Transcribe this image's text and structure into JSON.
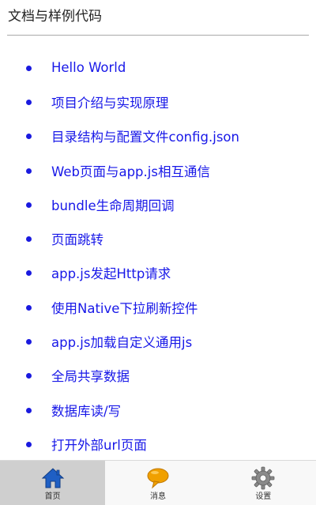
{
  "header": {
    "title": "文档与样例代码"
  },
  "docs": {
    "items": [
      {
        "label": "Hello World"
      },
      {
        "label": "项目介绍与实现原理"
      },
      {
        "label": "目录结构与配置文件config.json"
      },
      {
        "label": "Web页面与app.js相互通信"
      },
      {
        "label": "bundle生命周期回调"
      },
      {
        "label": "页面跳转"
      },
      {
        "label": "app.js发起Http请求"
      },
      {
        "label": "使用Native下拉刷新控件"
      },
      {
        "label": "app.js加载自定义通用js"
      },
      {
        "label": "全局共享数据"
      },
      {
        "label": "数据库读/写"
      },
      {
        "label": "打开外部url页面"
      }
    ]
  },
  "tabbar": {
    "tabs": [
      {
        "label": "首页",
        "icon": "home-icon",
        "active": true
      },
      {
        "label": "消息",
        "icon": "chat-bubble-icon",
        "active": false
      },
      {
        "label": "设置",
        "icon": "gear-icon",
        "active": false
      }
    ]
  },
  "colors": {
    "link": "#1818e8",
    "bullet": "#1a1adf",
    "home_icon": "#1f5fc4",
    "chat_icon": "#f0a000",
    "gear_icon": "#8a8a8a"
  }
}
